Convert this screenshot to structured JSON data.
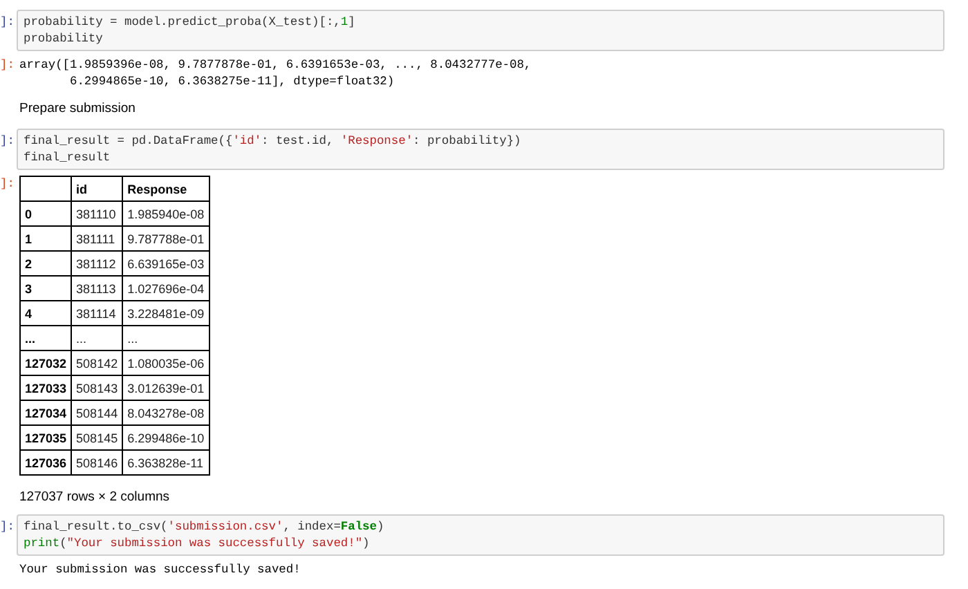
{
  "cells": [
    {
      "kind": "code",
      "prompt": "]:",
      "lines": [
        [
          {
            "kind": "p",
            "v": "probability = model.predict_proba(X_test)[:,"
          },
          {
            "kind": "n",
            "v": "1"
          },
          {
            "kind": "p",
            "v": "]"
          }
        ],
        [
          {
            "kind": "p",
            "v": "probability"
          }
        ]
      ]
    },
    {
      "kind": "output",
      "prompt": "]:",
      "lines": [
        "array([1.9859396e-08, 9.7877878e-01, 6.6391653e-03, ..., 8.0432777e-08,",
        "       6.2994865e-10, 6.3638275e-11], dtype=float32)"
      ]
    },
    {
      "kind": "markdown",
      "text": "Prepare submission"
    },
    {
      "kind": "code",
      "prompt": "]:",
      "lines": [
        [
          {
            "kind": "p",
            "v": "final_result = pd.DataFrame({"
          },
          {
            "kind": "s",
            "v": "'id'"
          },
          {
            "kind": "p",
            "v": ": test.id, "
          },
          {
            "kind": "s",
            "v": "'Response'"
          },
          {
            "kind": "p",
            "v": ": probability})"
          }
        ],
        [
          {
            "kind": "p",
            "v": "final_result"
          }
        ]
      ]
    },
    {
      "kind": "table",
      "prompt": "]:",
      "columns": [
        "id",
        "Response"
      ],
      "rows": [
        {
          "index": "0",
          "cells": [
            "381110",
            "1.985940e-08"
          ]
        },
        {
          "index": "1",
          "cells": [
            "381111",
            "9.787788e-01"
          ]
        },
        {
          "index": "2",
          "cells": [
            "381112",
            "6.639165e-03"
          ]
        },
        {
          "index": "3",
          "cells": [
            "381113",
            "1.027696e-04"
          ]
        },
        {
          "index": "4",
          "cells": [
            "381114",
            "3.228481e-09"
          ]
        },
        {
          "index": "...",
          "cells": [
            "...",
            "..."
          ]
        },
        {
          "index": "127032",
          "cells": [
            "508142",
            "1.080035e-06"
          ]
        },
        {
          "index": "127033",
          "cells": [
            "508143",
            "3.012639e-01"
          ]
        },
        {
          "index": "127034",
          "cells": [
            "508144",
            "8.043278e-08"
          ]
        },
        {
          "index": "127035",
          "cells": [
            "508145",
            "6.299486e-10"
          ]
        },
        {
          "index": "127036",
          "cells": [
            "508146",
            "6.363828e-11"
          ]
        }
      ],
      "caption": "127037 rows × 2 columns"
    },
    {
      "kind": "code",
      "prompt": "]:",
      "lines": [
        [
          {
            "kind": "p",
            "v": "final_result.to_csv("
          },
          {
            "kind": "s",
            "v": "'submission.csv'"
          },
          {
            "kind": "p",
            "v": ", index="
          },
          {
            "kind": "k",
            "v": "False"
          },
          {
            "kind": "p",
            "v": ")"
          }
        ],
        [
          {
            "kind": "b",
            "v": "print"
          },
          {
            "kind": "p",
            "v": "("
          },
          {
            "kind": "s",
            "v": "\"Your submission was successfully saved!\""
          },
          {
            "kind": "p",
            "v": ")"
          }
        ]
      ]
    },
    {
      "kind": "stream",
      "lines": [
        "Your submission was successfully saved!"
      ]
    }
  ]
}
